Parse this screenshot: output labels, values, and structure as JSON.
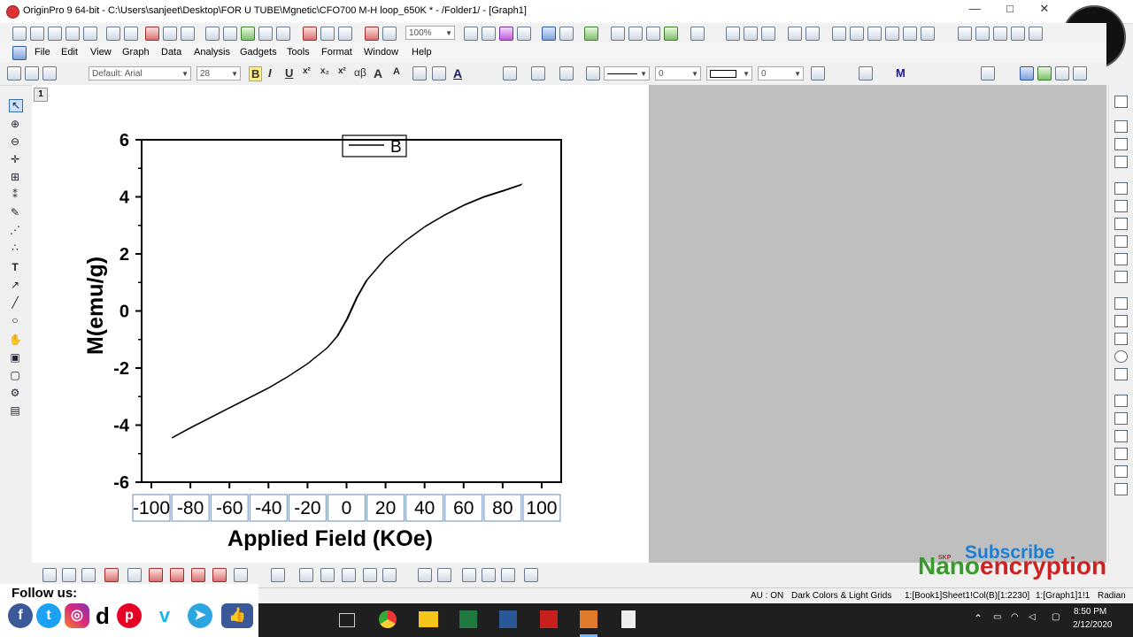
{
  "window": {
    "title": "OriginPro 9 64-bit - C:\\Users\\sanjeet\\Desktop\\FOR U TUBE\\Mgnetic\\CFO700 M-H loop_650K * - /Folder1/ - [Graph1]",
    "minimize": "—",
    "maximize": "□",
    "close": "✕"
  },
  "toolbar": {
    "zoom": "100%"
  },
  "menu": {
    "items": [
      "File",
      "Edit",
      "View",
      "Graph",
      "Data",
      "Analysis",
      "Gadgets",
      "Tools",
      "Format",
      "Window",
      "Help"
    ]
  },
  "format": {
    "font": "Default: Arial",
    "size": "28",
    "line_width": "0",
    "border_width": "0",
    "bold": "B",
    "italic": "I",
    "underline": "U",
    "greek": "αβ",
    "grow": "A",
    "text_color": "A"
  },
  "graph": {
    "layer_label": "1",
    "legend_label": "B"
  },
  "chart_data": {
    "type": "line",
    "xlabel": "Applied Field (KOe)",
    "ylabel": "M(emu/g)",
    "xlim": [
      -105,
      110
    ],
    "ylim": [
      -6,
      6
    ],
    "x_ticks": [
      "-100",
      "-80",
      "-60",
      "-40",
      "-20",
      "0",
      "20",
      "40",
      "60",
      "80",
      "100"
    ],
    "y_ticks": [
      "6",
      "4",
      "2",
      "0",
      "-2",
      "-4",
      "-6"
    ],
    "series": [
      {
        "name": "B",
        "color": "#000000",
        "x": [
          -89.5,
          -80,
          -70,
          -60,
          -50,
          -40,
          -30,
          -20,
          -10,
          -5,
          0,
          5,
          10,
          20,
          30,
          40,
          50,
          60,
          70,
          80,
          89.5
        ],
        "y": [
          -4.45,
          -4.1,
          -3.75,
          -3.4,
          -3.05,
          -2.7,
          -2.3,
          -1.85,
          -1.3,
          -0.9,
          -0.3,
          0.45,
          1.05,
          1.85,
          2.45,
          2.95,
          3.35,
          3.7,
          3.98,
          4.2,
          4.42
        ]
      }
    ]
  },
  "status": {
    "au": "AU : ON",
    "theme": "Dark Colors & Light Grids",
    "book": "1:[Book1]Sheet1!Col(B)[1:2230]",
    "graph": "1:[Graph1]1!1",
    "angle": "Radian"
  },
  "follow": {
    "label": "Follow us:",
    "icons": [
      "facebook-icon",
      "twitter-icon",
      "instagram-icon",
      "dailymotion-icon",
      "pinterest-icon",
      "vimeo-icon",
      "telegram-icon",
      "like-icon"
    ]
  },
  "branding": {
    "subscribe": "Subscribe",
    "name_part1": "Nano",
    "name_part2": "encryption",
    "tag": "SKP"
  },
  "taskbar": {
    "time": "8:50 PM",
    "date": "2/12/2020"
  }
}
